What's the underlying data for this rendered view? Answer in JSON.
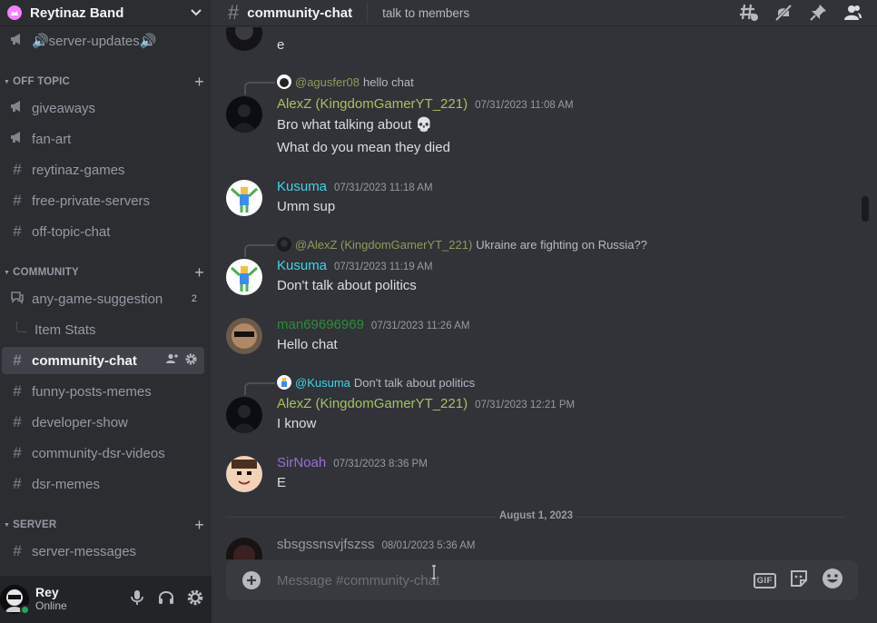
{
  "server": {
    "name": "Reytinaz Band"
  },
  "sidebar": {
    "rows": [
      {
        "kind": "channel",
        "icon": "megaphone-icon",
        "label": "🔊server-updates🔊",
        "top": 0
      },
      {
        "kind": "category",
        "label": "OFF TOPIC"
      },
      {
        "kind": "channel",
        "icon": "megaphone-icon",
        "label": "giveaways"
      },
      {
        "kind": "channel",
        "icon": "megaphone-icon",
        "label": "fan-art"
      },
      {
        "kind": "channel",
        "icon": "hash-icon",
        "label": "reytinaz-games"
      },
      {
        "kind": "channel",
        "icon": "hash-icon",
        "label": "free-private-servers"
      },
      {
        "kind": "channel",
        "icon": "hash-icon",
        "label": "off-topic-chat"
      },
      {
        "kind": "category",
        "label": "COMMUNITY"
      },
      {
        "kind": "channel",
        "icon": "forum-icon",
        "label": "any-game-suggestion",
        "badge": "2"
      },
      {
        "kind": "thread",
        "label": "Item Stats"
      },
      {
        "kind": "channel",
        "icon": "hash-icon",
        "label": "community-chat",
        "active": true
      },
      {
        "kind": "channel",
        "icon": "hash-icon",
        "label": "funny-posts-memes"
      },
      {
        "kind": "channel",
        "icon": "hash-icon",
        "label": "developer-show"
      },
      {
        "kind": "channel",
        "icon": "hash-icon",
        "label": "community-dsr-videos"
      },
      {
        "kind": "channel",
        "icon": "hash-icon",
        "label": "dsr-memes"
      },
      {
        "kind": "category",
        "label": "SERVER"
      },
      {
        "kind": "channel",
        "icon": "hash-icon",
        "label": "server-messages"
      }
    ]
  },
  "user": {
    "name": "Rey",
    "status": "Online"
  },
  "channel": {
    "name": "community-chat",
    "topic": "talk to members"
  },
  "messages": [
    {
      "text": "e",
      "continued": true
    },
    {
      "reply_to": {
        "author": "@agusfer08",
        "text": "hello chat",
        "color": "#8f9a5a"
      },
      "author": "AlexZ (KingdomGamerYT_221)",
      "color": "#a5c261",
      "timestamp": "07/31/2023 11:08 AM",
      "lines": [
        "Bro what talking about 💀",
        "What do you mean they died"
      ]
    },
    {
      "author": "Kusuma",
      "color": "#3dd6e8",
      "timestamp": "07/31/2023 11:18 AM",
      "lines": [
        "Umm sup"
      ]
    },
    {
      "reply_to": {
        "author": "@AlexZ (KingdomGamerYT_221)",
        "text": "Ukraine are fighting on Russia??",
        "color": "#8f9a5a"
      },
      "author": "Kusuma",
      "color": "#3dd6e8",
      "timestamp": "07/31/2023 11:19 AM",
      "lines": [
        "Don't talk about politics"
      ]
    },
    {
      "author": "man69696969",
      "color": "#2e8b3a",
      "timestamp": "07/31/2023 11:26 AM",
      "lines": [
        "Hello chat"
      ]
    },
    {
      "reply_to": {
        "author": "@Kusuma",
        "text": "Don't talk about politics",
        "color": "#3dd6e8"
      },
      "author": "AlexZ (KingdomGamerYT_221)",
      "color": "#a5c261",
      "timestamp": "07/31/2023 12:21 PM",
      "lines": [
        "I know"
      ]
    },
    {
      "author": "SirNoah",
      "color": "#9b6fd6",
      "timestamp": "07/31/2023 8:36 PM",
      "lines": [
        "E"
      ]
    },
    {
      "date_divider": "August 1, 2023"
    },
    {
      "author": "sbsgssnsvjfszss",
      "color": "#949ba4",
      "timestamp": "08/01/2023 5:36 AM",
      "lines": []
    }
  ],
  "composer": {
    "placeholder": "Message #community-chat",
    "gif_label": "GIF"
  },
  "colors": {
    "accent": "#5865f2",
    "online": "#23a55a"
  }
}
